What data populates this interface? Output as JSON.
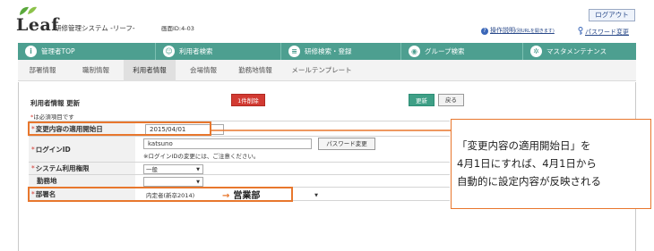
{
  "header": {
    "logo_text": "Leaf",
    "system_name": "研修管理システム -リーフ-",
    "screen_id": "画面ID:4-03",
    "logout_label": "ログアウト",
    "help_label": "操作説明",
    "help_sub": "(別URLを開きます)",
    "password_change_label": "パスワード変更"
  },
  "main_nav": {
    "items": [
      {
        "label": "管理者TOP",
        "icon": "info-icon"
      },
      {
        "label": "利用者検索",
        "icon": "user-icon"
      },
      {
        "label": "研修検索・登録",
        "icon": "list-icon"
      },
      {
        "label": "グループ検索",
        "icon": "group-icon"
      },
      {
        "label": "マスタメンテナンス",
        "icon": "gear-icon"
      }
    ]
  },
  "sub_nav": {
    "tabs": [
      "部署情報",
      "職制情報",
      "利用者情報",
      "会場情報",
      "勤務地情報",
      "メールテンプレート"
    ],
    "active": "利用者情報"
  },
  "form": {
    "title": "利用者情報 更新",
    "delete_label": "1件削除",
    "update_label": "更新",
    "back_label": "戻る",
    "required_note": "は必須項目です",
    "required_mark": "*",
    "fields": {
      "effective_date": {
        "label": "変更内容の適用開始日",
        "value": "2015/04/01"
      },
      "login_id": {
        "label": "ログインID",
        "value": "katsuno",
        "button": "パスワード変更",
        "note": "※ログインIDの変更には、ご注意ください。"
      },
      "permission": {
        "label": "システム利用権限",
        "value": "一般"
      },
      "work_location": {
        "label": "勤務地",
        "value": ""
      },
      "department": {
        "label": "部署名",
        "value": "内定者(新卒2014)"
      }
    }
  },
  "annotation": {
    "callout_lines": [
      "「変更内容の適用開始日」を",
      "4月1日にすれば、4月1日から",
      "自動的に設定内容が反映される"
    ],
    "arrow": "→",
    "new_department": "営業部"
  },
  "colors": {
    "nav_green": "#4d9f90",
    "highlight_orange": "#e8772d",
    "delete_red": "#d23a32",
    "update_green": "#3e9f86"
  }
}
